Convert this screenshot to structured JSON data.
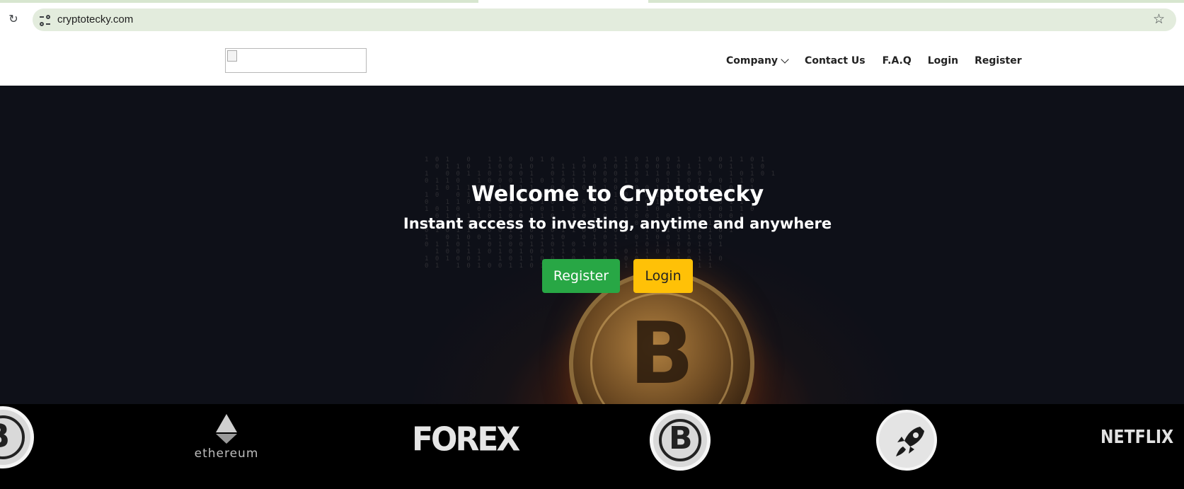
{
  "browser": {
    "url": "cryptotecky.com",
    "icons": {
      "reload": "reload-icon",
      "site_info": "site-info-icon",
      "bookmark": "star-icon"
    }
  },
  "header": {
    "logo_alt": "",
    "nav": {
      "company": "Company",
      "contact": "Contact Us",
      "faq": "F.A.Q",
      "login": "Login",
      "register": "Register"
    }
  },
  "hero": {
    "title": "Welcome to Cryptotecky",
    "subtitle": "Instant access to investing, anytime and anywhere",
    "register_button": "Register",
    "login_button": "Login",
    "colors": {
      "register": "#28a745",
      "login": "#ffc107"
    },
    "background_glyph": "B"
  },
  "partners": {
    "ethereum": "ethereum",
    "forex": "FOREX",
    "netflix": "NETFLIX",
    "bitcoin_glyph": "B",
    "icons": [
      "bitcoin-icon",
      "ethereum-icon",
      "forex-logo",
      "bitcoin-icon",
      "rocket-icon",
      "netflix-logo"
    ]
  }
}
